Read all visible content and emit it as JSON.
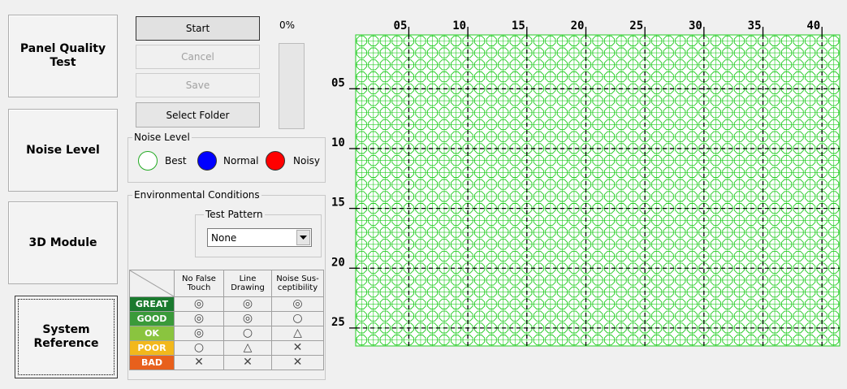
{
  "side_buttons": {
    "panel_quality": "Panel Quality\nTest",
    "noise_level": "Noise Level",
    "module_3d": "3D Module",
    "system_reference": "System\nReference"
  },
  "actions": {
    "start": "Start",
    "cancel": "Cancel",
    "save": "Save",
    "select_folder": "Select Folder"
  },
  "progress": {
    "label": "0%",
    "value": 0
  },
  "noise_level": {
    "title": "Noise Level",
    "best": "Best",
    "normal": "Normal",
    "noisy": "Noisy",
    "colors": {
      "best": "#ffffff",
      "normal": "#0000ff",
      "noisy": "#ff0000"
    }
  },
  "environment": {
    "title": "Environmental Conditions",
    "test_pattern": {
      "title": "Test Pattern",
      "selected": "None"
    }
  },
  "rating_table": {
    "headers": [
      "No False\nTouch",
      "Line\nDrawing",
      "Noise Sus-\nceptibility"
    ],
    "rows": [
      {
        "label": "GREAT",
        "color": "#1a7a2e",
        "values": [
          "◎",
          "◎",
          "◎"
        ]
      },
      {
        "label": "GOOD",
        "color": "#3a9a3a",
        "values": [
          "◎",
          "◎",
          "○"
        ]
      },
      {
        "label": "OK",
        "color": "#8ac43f",
        "values": [
          "◎",
          "○",
          "△"
        ]
      },
      {
        "label": "POOR",
        "color": "#f2b81c",
        "values": [
          "○",
          "△",
          "✕"
        ]
      },
      {
        "label": "BAD",
        "color": "#e8601c",
        "values": [
          "✕",
          "✕",
          "✕"
        ]
      }
    ]
  },
  "grid": {
    "columns": 41,
    "rows": 26,
    "color": "#22cc22",
    "x_labels": [
      "05",
      "10",
      "15",
      "20",
      "25",
      "30",
      "35",
      "40"
    ],
    "y_labels": [
      "05",
      "10",
      "15",
      "20",
      "25"
    ]
  }
}
